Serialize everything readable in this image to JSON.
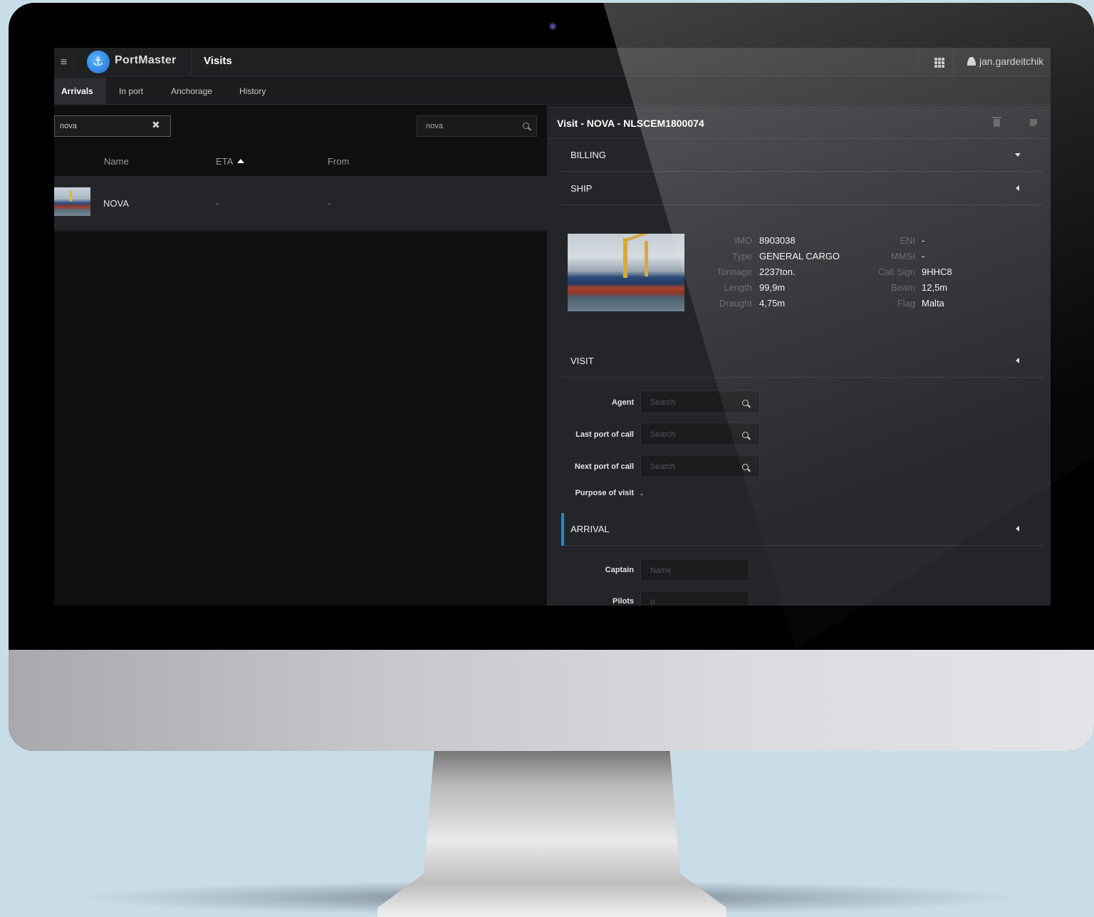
{
  "app": {
    "brand": "PortMaster",
    "section": "Visits",
    "user": "jan.gardeitchik",
    "accent": "#1e8bd8"
  },
  "tabs": [
    {
      "label": "Arrivals",
      "active": true
    },
    {
      "label": "In port",
      "active": false
    },
    {
      "label": "Anchorage",
      "active": false
    },
    {
      "label": "History",
      "active": false
    }
  ],
  "list": {
    "filter_value": "nova",
    "search_value": "nova",
    "columns": {
      "name": "Name",
      "eta": "ETA",
      "from": "From"
    },
    "sort_column": "ETA",
    "sort_direction": "ascending",
    "rows": [
      {
        "name": "NOVA",
        "eta": "-",
        "from": "-"
      }
    ]
  },
  "detail": {
    "title": "Visit - NOVA - NLSCEM1800074",
    "sections": {
      "billing": "BILLING",
      "ship": "SHIP",
      "visit": "VISIT",
      "arrival": "ARRIVAL"
    },
    "ship": {
      "left": [
        {
          "label": "IMO",
          "value": "8903038"
        },
        {
          "label": "Type",
          "value": "GENERAL CARGO"
        },
        {
          "label": "Tonnage",
          "value": "2237ton."
        },
        {
          "label": "Length",
          "value": "99,9m"
        },
        {
          "label": "Draught",
          "value": "4,75m"
        }
      ],
      "right": [
        {
          "label": "ENI",
          "value": "-"
        },
        {
          "label": "MMSI",
          "value": "-"
        },
        {
          "label": "Call Sign",
          "value": "9HHC8"
        },
        {
          "label": "Beam",
          "value": "12,5m"
        },
        {
          "label": "Flag",
          "value": "Malta"
        }
      ]
    },
    "visit": {
      "agent_label": "Agent",
      "agent_placeholder": "Search",
      "last_port_label": "Last port of call",
      "last_port_placeholder": "Search",
      "next_port_label": "Next port of call",
      "next_port_placeholder": "Search",
      "purpose_label": "Purpose of visit",
      "purpose_value": "-"
    },
    "arrival": {
      "captain_label": "Captain",
      "captain_placeholder": "Name",
      "pilots_label": "Pilots",
      "pilots_placeholder": "0"
    }
  }
}
